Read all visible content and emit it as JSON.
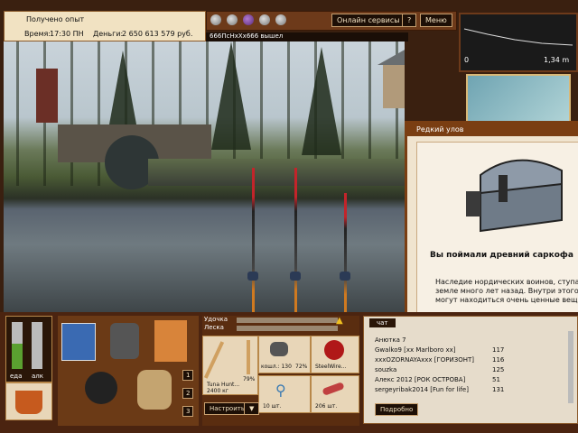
{
  "status": {
    "received_label": "Получено опыт",
    "time_label": "Время:",
    "time_value": "17:30 ПН",
    "money_label": "Деньги:",
    "money_value": "2 650 613 579 руб."
  },
  "toolbar": {
    "online_label": "Онлайн сервисы",
    "help_label": "?",
    "menu_label": "Меню"
  },
  "chat_notice": "666ПсНхХх666 вышел",
  "depth": {
    "value": "1,34 m",
    "marker": "0"
  },
  "popup": {
    "title": "Редкий улов",
    "headline": "Вы поймали древний саркофа",
    "text_line1": "Наследие нордических воинов, ступа",
    "text_line2": "земле много лет назад. Внутри этого",
    "text_line3": "могут находиться очень ценные вещи"
  },
  "gauges": {
    "left_label": "еда",
    "right_label": "алк"
  },
  "tackle": {
    "rod_label": "Удочка",
    "line_label": "Леска",
    "rod_name": "Tuna Hunt...",
    "rod_weight": "2400 кг",
    "rod_pct": "79%",
    "reel_label": "кошл.: 130",
    "reel_pct": "72%",
    "line_name": "SteelWire...",
    "hook_count": "10 шт.",
    "lure_count": "206 шт.",
    "setup_button": "Настроить",
    "slot_numbers": [
      "1",
      "2",
      "3"
    ]
  },
  "chat": {
    "tab1": "чат",
    "rows": [
      {
        "name": "Анютка 7",
        "num": ""
      },
      {
        "name": "Gwalko9 [xx Marlboro xx]",
        "num": "117"
      },
      {
        "name": "xxxOZORNAYAxxx [ГОРИЗОНТ]",
        "num": "116"
      },
      {
        "name": "souzka",
        "num": "125"
      },
      {
        "name": "Алекс 2012 [РОК ОСТРОВА]",
        "num": "51"
      },
      {
        "name": "sergeyribak2014 [Fun for life]",
        "num": "131"
      }
    ],
    "more_button": "Подробно"
  }
}
